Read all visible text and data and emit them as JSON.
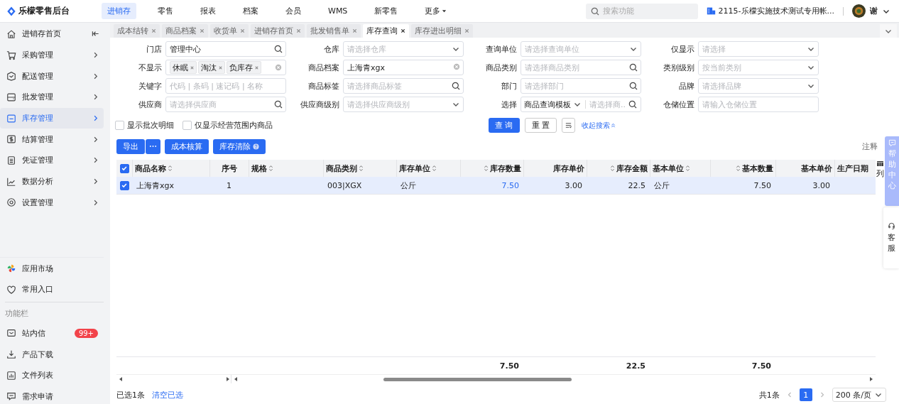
{
  "app": {
    "logo": "乐檬零售后台"
  },
  "nav": [
    {
      "label": "进销存",
      "selected": true,
      "kind": "link"
    },
    {
      "label": "零售",
      "selected": false,
      "kind": "link"
    },
    {
      "label": "报表",
      "selected": false,
      "kind": "link"
    },
    {
      "label": "档案",
      "selected": false,
      "kind": "link"
    },
    {
      "label": "会员",
      "selected": false,
      "kind": "link"
    },
    {
      "label": "WMS",
      "selected": false,
      "kind": "link"
    },
    {
      "label": "新零售",
      "selected": false,
      "kind": "link"
    },
    {
      "label": "更多",
      "selected": false,
      "kind": "menu"
    }
  ],
  "search": {
    "placeholder": "搜索功能"
  },
  "account": {
    "text": "2115-乐檬实施技术测试专用帐..."
  },
  "user": {
    "name": "谢"
  },
  "sidebar": {
    "items": [
      {
        "label": "进销存首页",
        "selected": false,
        "kind": "collapse"
      },
      {
        "label": "采购管理",
        "selected": false,
        "kind": "menu"
      },
      {
        "label": "配送管理",
        "selected": false,
        "kind": "menu"
      },
      {
        "label": "批发管理",
        "selected": false,
        "kind": "menu"
      },
      {
        "label": "库存管理",
        "selected": true,
        "kind": "menu"
      },
      {
        "label": "结算管理",
        "selected": false,
        "kind": "menu"
      },
      {
        "label": "凭证管理",
        "selected": false,
        "kind": "menu"
      },
      {
        "label": "数据分析",
        "selected": false,
        "kind": "menu"
      },
      {
        "label": "设置管理",
        "selected": false,
        "kind": "menu"
      }
    ],
    "extras": [
      {
        "label": "应用市场"
      },
      {
        "label": "常用入口"
      }
    ],
    "section": "功能栏",
    "tools": [
      {
        "label": "站内信",
        "badge": "99+"
      },
      {
        "label": "产品下载"
      },
      {
        "label": "文件列表"
      },
      {
        "label": "需求申请"
      }
    ]
  },
  "tabs": [
    {
      "label": "成本结转",
      "selected": false
    },
    {
      "label": "商品档案",
      "selected": false
    },
    {
      "label": "收货单",
      "selected": false
    },
    {
      "label": "进销存首页",
      "selected": false
    },
    {
      "label": "批发销售单",
      "selected": false
    },
    {
      "label": "库存查询",
      "selected": true
    },
    {
      "label": "库存进出明细",
      "selected": false
    }
  ],
  "filters": [
    {
      "label": "门店",
      "kind": "search",
      "value": "管理中心"
    },
    {
      "label": "仓库",
      "kind": "select",
      "placeholder": "请选择仓库"
    },
    {
      "label": "查询单位",
      "kind": "select",
      "placeholder": "请选择查询单位"
    },
    {
      "label": "仅显示",
      "kind": "select",
      "placeholder": "请选择"
    },
    {
      "label": "不显示",
      "kind": "tags",
      "tags": [
        "休眠",
        "淘汰",
        "负库存"
      ]
    },
    {
      "label": "商品档案",
      "kind": "clear",
      "value": "上海青xgx"
    },
    {
      "label": "商品类别",
      "kind": "search",
      "placeholder": "请选择商品类别"
    },
    {
      "label": "类别级别",
      "kind": "select",
      "placeholder": "按当前类别"
    },
    {
      "label": "关键字",
      "kind": "text",
      "placeholder": "代码 | 条码 | 速记码 | 名称"
    },
    {
      "label": "商品标签",
      "kind": "search",
      "placeholder": "请选择商品标签"
    },
    {
      "label": "部门",
      "kind": "search",
      "placeholder": "请选择部门"
    },
    {
      "label": "品牌",
      "kind": "select",
      "placeholder": "请选择品牌"
    },
    {
      "label": "供应商",
      "kind": "search",
      "placeholder": "请选择供应商"
    },
    {
      "label": "供应商级别",
      "kind": "select",
      "placeholder": "请选择供应商级别"
    },
    {
      "label": "选择",
      "kind": "template",
      "value": "商品查询模板",
      "placeholder": "请选择商..."
    },
    {
      "label": "仓储位置",
      "kind": "text",
      "placeholder": "请输入仓储位置"
    }
  ],
  "checkboxes": [
    {
      "label": "显示批次明细",
      "checked": false
    },
    {
      "label": "仅显示经营范围内商品",
      "checked": false
    }
  ],
  "search_buttons": {
    "query": "查 询",
    "reset": "重 置",
    "collapse": "收起搜索"
  },
  "actions": {
    "export": "导出",
    "cost": "成本核算",
    "clear": "库存清除",
    "note": "注释"
  },
  "table": {
    "header_checked": true,
    "settings": "列",
    "columns": [
      {
        "label": "商品名称",
        "kind": "text",
        "sortable": true
      },
      {
        "label": "序号",
        "kind": "index",
        "sortable": false
      },
      {
        "label": "规格",
        "kind": "text",
        "sortable": true
      },
      {
        "label": "商品类别",
        "kind": "text",
        "sortable": true
      },
      {
        "label": "库存单位",
        "kind": "text",
        "sortable": true
      },
      {
        "label": "库存数量",
        "kind": "link",
        "sortable": true,
        "total": "7.50"
      },
      {
        "label": "库存单价",
        "kind": "number",
        "sortable": false
      },
      {
        "label": "库存金额",
        "kind": "number",
        "sortable": true,
        "total": "22.5"
      },
      {
        "label": "基本单位",
        "kind": "text",
        "sortable": true
      },
      {
        "label": "基本数量",
        "kind": "number",
        "sortable": true,
        "total": "7.50"
      },
      {
        "label": "基本单价",
        "kind": "number",
        "sortable": false
      },
      {
        "label": "生产日期",
        "kind": "text",
        "sortable": false
      }
    ],
    "rows": [
      {
        "selected": true,
        "cells": [
          "上海青xgx",
          "1",
          "",
          "003|XGX",
          "公斤",
          "7.50",
          "3.00",
          "22.5",
          "公斤",
          "7.50",
          "3.00",
          ""
        ]
      }
    ]
  },
  "footer": {
    "selected_text": "已选1条",
    "clear": "清空已选",
    "total": "共1条",
    "pages": [
      {
        "label": "1",
        "selected": true
      }
    ],
    "page_size": "200 条/页"
  },
  "help": {
    "label": "帮助中心",
    "service": "客服"
  }
}
